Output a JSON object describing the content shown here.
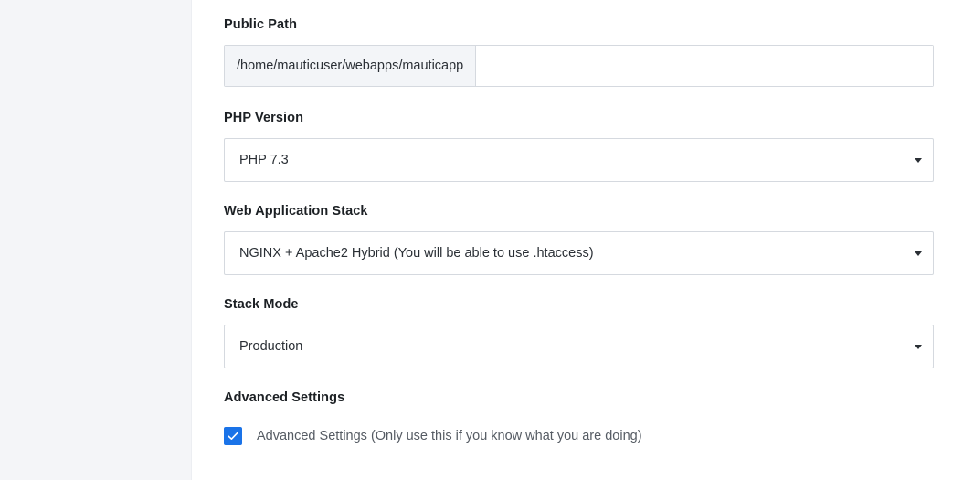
{
  "form": {
    "public_path": {
      "label": "Public Path",
      "prefix": "/home/mauticuser/webapps/mauticapp",
      "value": "",
      "placeholder": ""
    },
    "php_version": {
      "label": "PHP Version",
      "selected": "PHP 7.3"
    },
    "web_app_stack": {
      "label": "Web Application Stack",
      "selected": "NGINX + Apache2 Hybrid (You will be able to use .htaccess)"
    },
    "stack_mode": {
      "label": "Stack Mode",
      "selected": "Production"
    },
    "advanced_settings": {
      "label": "Advanced Settings",
      "checkbox_label": "Advanced Settings (Only use this if you know what you are doing)",
      "checked": true
    }
  },
  "icons": {
    "dropdown": "chevron-down-icon",
    "checkmark": "check-icon"
  },
  "colors": {
    "sidebar_bg": "#f4f5f8",
    "accent": "#1a73e8",
    "border": "#d5d9df",
    "prefix_bg": "#f3f5f8"
  }
}
